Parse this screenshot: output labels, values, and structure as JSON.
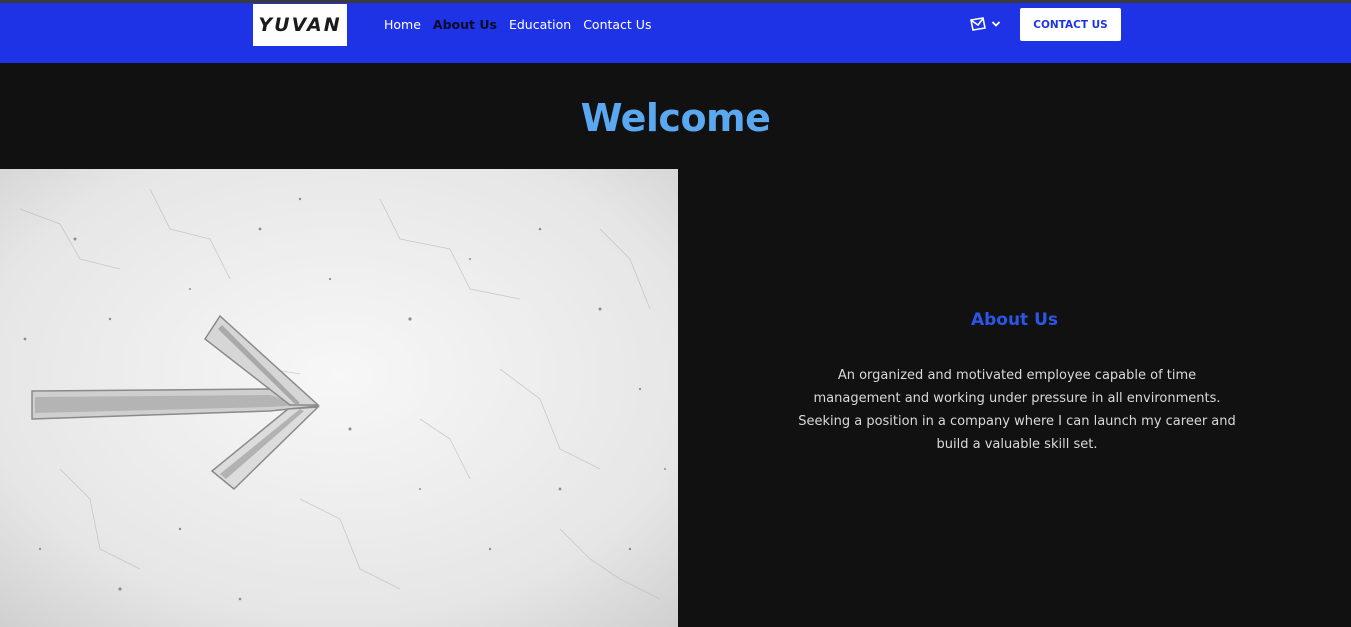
{
  "header": {
    "logo_text": "YUVAN",
    "nav": [
      {
        "label": "Home",
        "active": false
      },
      {
        "label": "About Us",
        "active": true
      },
      {
        "label": "Education",
        "active": false
      },
      {
        "label": "Contact Us",
        "active": false
      }
    ],
    "mail_icon": "envelope-icon",
    "dropdown_icon": "chevron-down-icon",
    "contact_button": "CONTACT US"
  },
  "hero": {
    "title": "Welcome"
  },
  "about": {
    "title": "About Us",
    "text": "An organized and motivated employee capable of time management and working under pressure in all environments. Seeking a position in a company where I can launch my career and build a valuable skill set."
  },
  "colors": {
    "header_bg": "#1f33e6",
    "page_bg": "#111111",
    "welcome": "#5aa9f0",
    "about_title": "#2b56e8"
  }
}
